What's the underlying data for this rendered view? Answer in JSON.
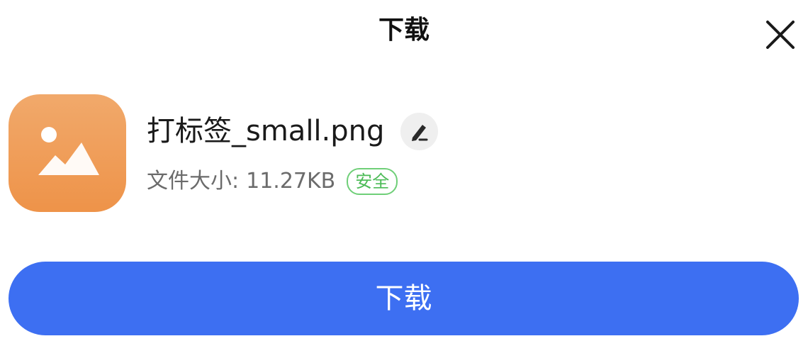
{
  "dialog": {
    "title": "下载",
    "close_icon": "close-icon"
  },
  "file": {
    "icon": "image-file-icon",
    "name": "打标签_small.png",
    "rename_icon": "pencil-icon",
    "size_label": "文件大小:",
    "size_value": "11.27KB",
    "safety_badge": "安全"
  },
  "actions": {
    "download_label": "下载"
  },
  "colors": {
    "primary": "#3d6ff2",
    "icon_bg": "#ef9b55",
    "safe": "#4cbb57"
  }
}
